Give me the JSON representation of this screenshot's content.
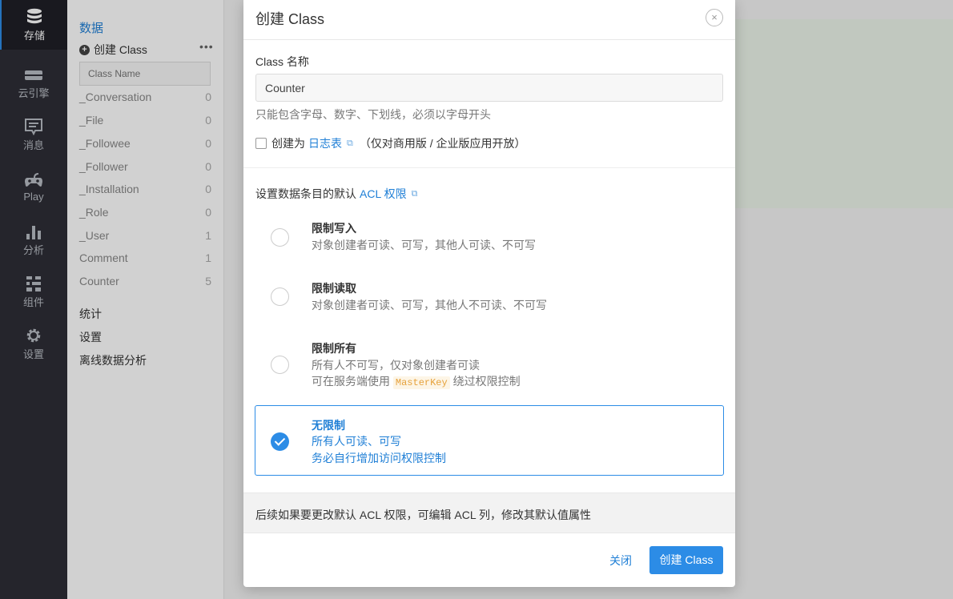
{
  "rail": {
    "items": [
      {
        "label": "存储",
        "icon": "database-icon"
      },
      {
        "label": "云引擎",
        "icon": "server-icon"
      },
      {
        "label": "消息",
        "icon": "message-icon"
      },
      {
        "label": "Play",
        "icon": "gamepad-icon"
      },
      {
        "label": "分析",
        "icon": "bar-chart-icon"
      },
      {
        "label": "组件",
        "icon": "components-icon"
      },
      {
        "label": "设置",
        "icon": "gear-icon"
      }
    ]
  },
  "sidebar": {
    "title": "数据",
    "create_label": "创建 Class",
    "more": "•••",
    "search_placeholder": "Class Name",
    "classes": [
      {
        "name": "_Conversation",
        "count": "0"
      },
      {
        "name": "_File",
        "count": "0"
      },
      {
        "name": "_Followee",
        "count": "0"
      },
      {
        "name": "_Follower",
        "count": "0"
      },
      {
        "name": "_Installation",
        "count": "0"
      },
      {
        "name": "_Role",
        "count": "0"
      },
      {
        "name": "_User",
        "count": "1"
      },
      {
        "name": "Comment",
        "count": "1"
      },
      {
        "name": "Counter",
        "count": "5"
      }
    ],
    "links": [
      "统计",
      "设置",
      "离线数据分析"
    ]
  },
  "modal": {
    "title": "创建 Class",
    "close_symbol": "×",
    "name_label": "Class 名称",
    "name_value": "Counter",
    "name_hint": "只能包含字母、数字、下划线，必须以字母开头",
    "log_prefix": "创建为",
    "log_link": "日志表",
    "log_suffix": "（仅对商用版 / 企业版应用开放）",
    "acl_prefix": "设置数据条目的默认",
    "acl_link": "ACL 权限",
    "ext_symbol": "⧉",
    "options": [
      {
        "title": "限制写入",
        "desc": "对象创建者可读、可写，其他人可读、不可写",
        "selected": false
      },
      {
        "title": "限制读取",
        "desc": "对象创建者可读、可写，其他人不可读、不可写",
        "selected": false
      },
      {
        "title": "限制所有",
        "desc": "所有人不可写，仅对象创建者可读",
        "desc2_prefix": "可在服务端使用",
        "desc2_code": "MasterKey",
        "desc2_suffix": "绕过权限控制",
        "selected": false
      },
      {
        "title": "无限制",
        "desc": "所有人可读、可写",
        "desc2": "务必自行增加访问权限控制",
        "selected": true
      }
    ],
    "footer_note": "后续如果要更改默认 ACL 权限，可编辑 ACL 列，修改其默认值属性",
    "cancel_label": "关闭",
    "submit_label": "创建 Class"
  }
}
